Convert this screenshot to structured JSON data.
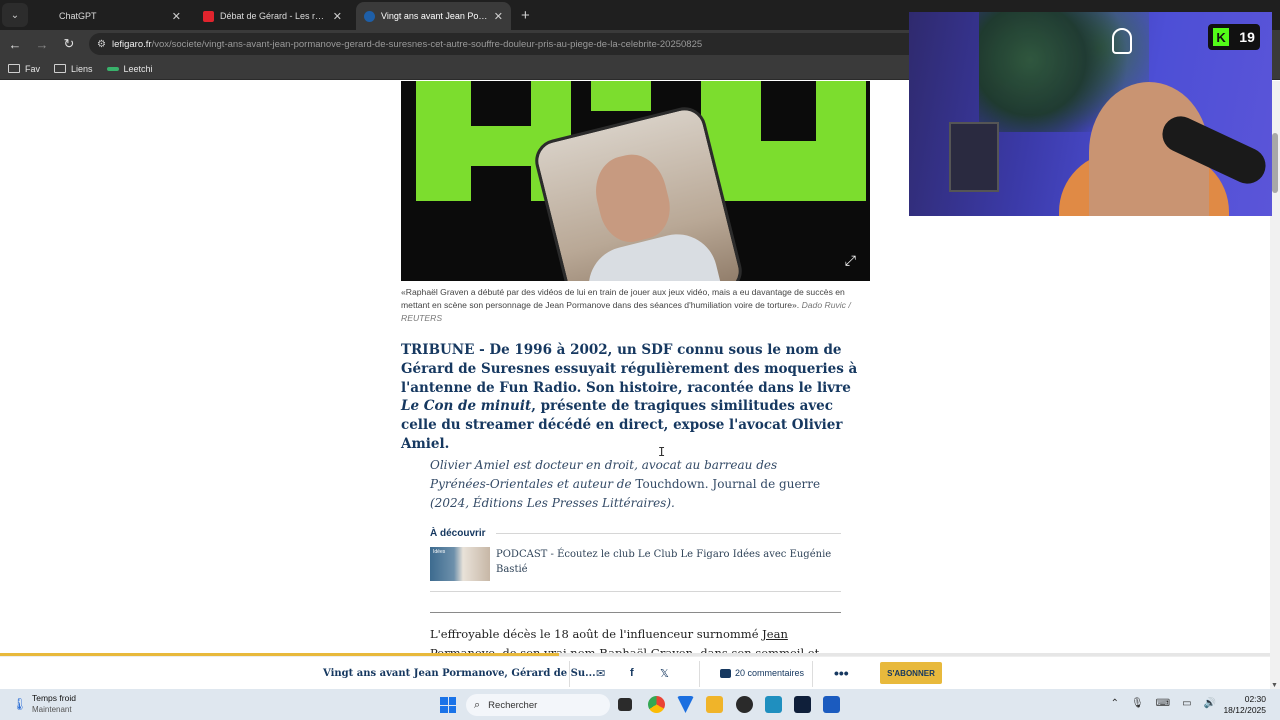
{
  "browser": {
    "tabs": [
      {
        "title": "ChatGPT",
        "active": false
      },
      {
        "title": "Débat de Gérard - Les ronflements",
        "active": false
      },
      {
        "title": "Vingt ans avant Jean Pormanove",
        "active": true
      }
    ],
    "url_host": "lefigaro.fr",
    "url_path": "/vox/societe/vingt-ans-avant-jean-pormanove-gerard-de-suresnes-cet-autre-souffre-douleur-pris-au-piege-de-la-celebrite-20250825",
    "bookmarks": [
      "Fav",
      "Liens",
      "Leetchi"
    ]
  },
  "article": {
    "caption": "«Raphaël Graven a débuté par des vidéos de lui en train de jouer aux jeux vidéo, mais a eu davantage de succès en mettant en scène son personnage de Jean Pormanove dans des séances d'humiliation voire de torture».",
    "caption_credit": "Dado Ruvic / REUTERS",
    "chapo_part1": "TRIBUNE - De 1996 à 2002, un SDF connu sous le nom de Gérard de Suresnes essuyait régulièrement des moqueries à l'antenne de Fun Radio. Son histoire, racontée dans le livre ",
    "chapo_book": "Le Con de minuit",
    "chapo_part2": ", présente de tragiques similitudes avec celle du streamer décédé en direct, expose l'avocat Olivier Amiel.",
    "bio_part1": "Olivier Amiel est docteur en droit, avocat au barreau des Pyrénées-Orientales et auteur de ",
    "bio_book": "Touchdown. Journal de guerre",
    "bio_part2": " (2024, Éditions Les Presses Littéraires).",
    "discover_heading": "À découvrir",
    "discover_thumb_tag": "Idées",
    "discover_text": "PODCAST - Écoutez le club Le Club Le Figaro Idées avec Eugénie Bastié",
    "body_part1": "L'effroyable décès le 18 août de l'influenceur surnommé ",
    "body_link": "Jean Pormanove",
    "body_part2": ", de son vrai nom Raphaël Graven, dans son sommeil et"
  },
  "sticky_bar": {
    "title": "Vingt ans avant Jean Pormanove, Gérard de Su...",
    "comments": "20 commentaires",
    "more": "•••",
    "subscribe": "S'ABONNER",
    "progress_fraction": 0.44
  },
  "webcam": {
    "kick_letter": "K",
    "viewer_count": "19"
  },
  "taskbar": {
    "weather_title": "Temps froid",
    "weather_sub": "Maintenant",
    "search_placeholder": "Rechercher",
    "time": "02:30",
    "date": "18/12/2025"
  },
  "colors": {
    "figaro_navy": "#163860",
    "accent_gold": "#e8b93c",
    "kick_green": "#53fc18"
  }
}
